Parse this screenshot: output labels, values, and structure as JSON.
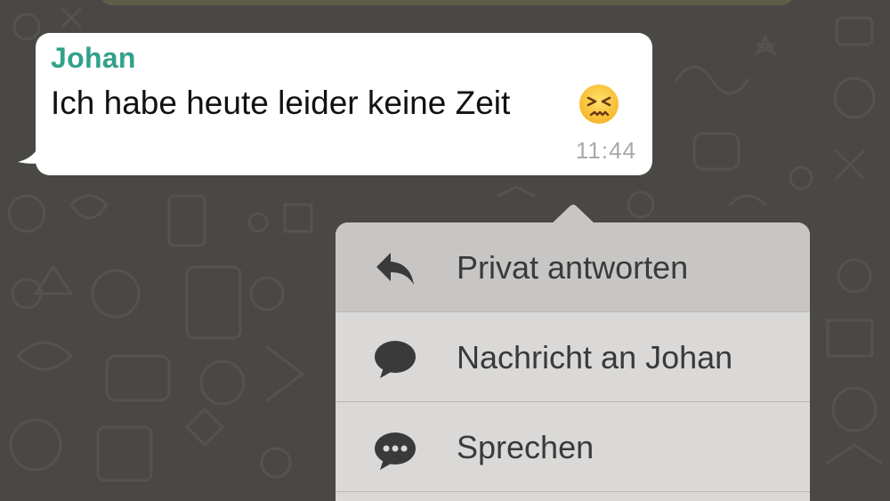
{
  "message": {
    "sender": "Johan",
    "text": "Ich habe heute leider keine Zeit",
    "emoji": "persevering-face",
    "time": "11:44"
  },
  "context_menu": {
    "items": [
      {
        "label": "Privat antworten",
        "icon": "reply-icon",
        "highlighted": true
      },
      {
        "label": "Nachricht an Johan",
        "icon": "speech-bubble-icon",
        "highlighted": false
      },
      {
        "label": "Sprechen",
        "icon": "speech-bubble-dots-icon",
        "highlighted": false
      }
    ]
  },
  "colors": {
    "chat_background": "#4a4845",
    "bubble": "#ffffff",
    "sender_name": "#31a18c",
    "timestamp": "#a9a9a9",
    "menu_background": "#dad9d8",
    "menu_highlight": "#c7c6c4"
  }
}
